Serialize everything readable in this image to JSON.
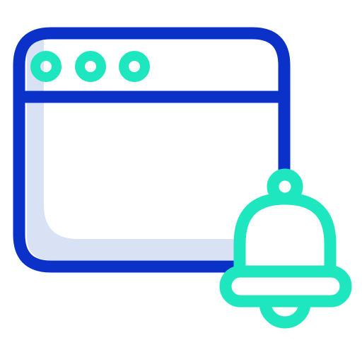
{
  "icon": {
    "name": "browser-notification-icon",
    "parts": [
      "browser-window-icon",
      "window-control-dots",
      "bell-icon"
    ]
  },
  "colors": {
    "window_stroke": "#0a32c8",
    "window_shade": "#d8e2f4",
    "accent": "#1ee6be",
    "background": "#ffffff"
  }
}
